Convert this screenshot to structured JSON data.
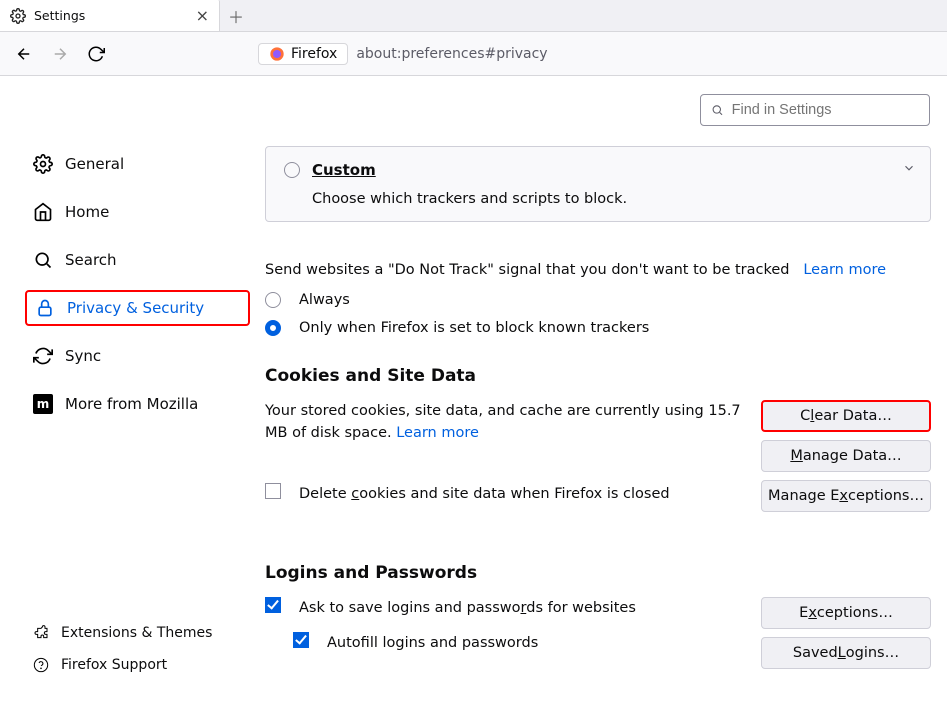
{
  "tab": {
    "title": "Settings"
  },
  "url": {
    "identity_label": "Firefox",
    "text": "about:preferences#privacy"
  },
  "search": {
    "placeholder": "Find in Settings"
  },
  "sidebar": {
    "items": [
      {
        "label": "General"
      },
      {
        "label": "Home"
      },
      {
        "label": "Search"
      },
      {
        "label": "Privacy & Security"
      },
      {
        "label": "Sync"
      },
      {
        "label": "More from Mozilla"
      }
    ],
    "footer": [
      {
        "label": "Extensions & Themes"
      },
      {
        "label": "Firefox Support"
      }
    ]
  },
  "custom": {
    "title": "Custom",
    "desc": "Choose which trackers and scripts to block."
  },
  "dnt": {
    "text": "Send websites a \"Do Not Track\" signal that you don't want to be tracked",
    "learn": "Learn more",
    "opt_always": "Always",
    "opt_only": "Only when Firefox is set to block known trackers"
  },
  "cookies": {
    "heading": "Cookies and Site Data",
    "text_pre": "Your stored cookies, site data, and cache are currently using ",
    "text_size": "15.7 MB",
    "text_post": " of disk space.   ",
    "learn": "Learn more",
    "delete_on_close": "Delete cookies and site data when Firefox is closed",
    "btn_clear": "Clear Data…",
    "btn_manage": "Manage Data…",
    "btn_exceptions": "Manage Exceptions…"
  },
  "logins": {
    "heading": "Logins and Passwords",
    "ask": "Ask to save logins and passwords for websites",
    "autofill": "Autofill logins and passwords",
    "btn_exceptions": "Exceptions…",
    "btn_saved": "Saved Logins…"
  }
}
